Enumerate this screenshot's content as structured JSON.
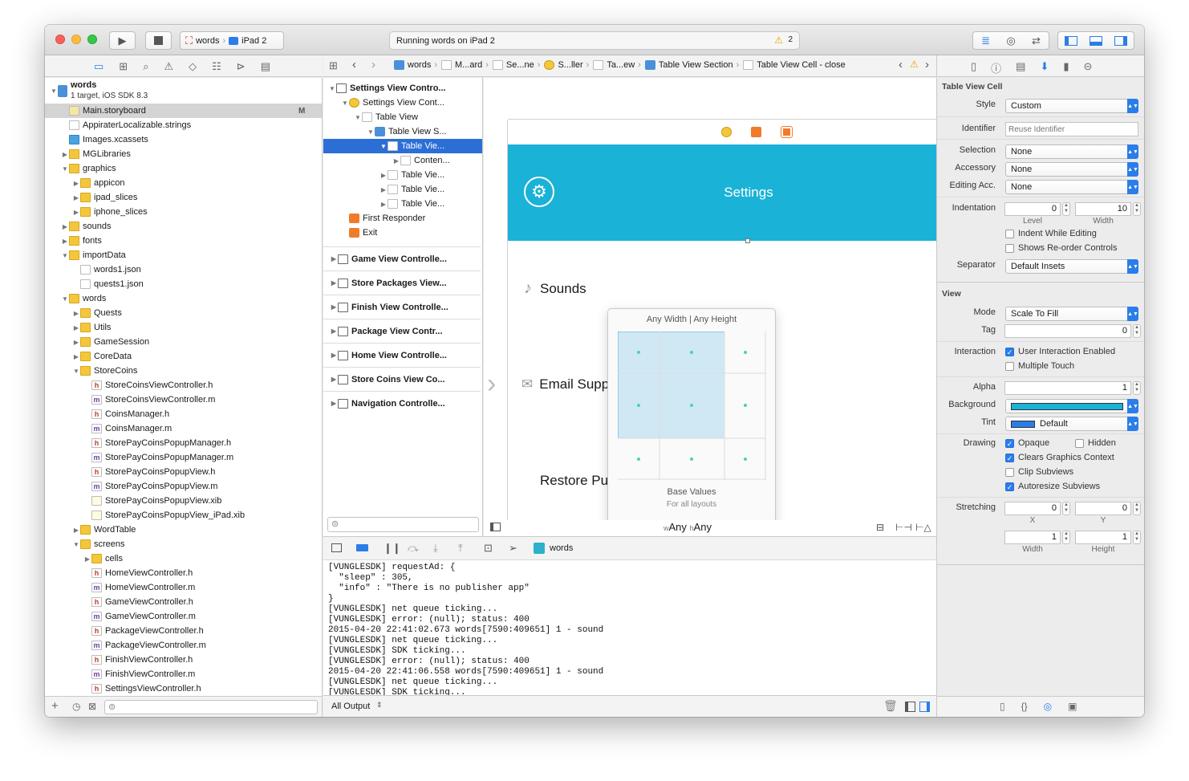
{
  "toolbar": {
    "scheme_target": "words",
    "scheme_device": "iPad 2",
    "activity_text": "Running words on iPad 2",
    "warning_count": "2"
  },
  "jumpbar": {
    "crumbs": [
      "words",
      "M...ard",
      "Se...ne",
      "S...ller",
      "Ta...ew",
      "Table View Section",
      "Table View Cell - close"
    ]
  },
  "navigator": {
    "project_name": "words",
    "project_subtitle": "1 target, iOS SDK 8.3",
    "badge_m": "M",
    "items": [
      {
        "label": "Main.storyboard",
        "indent": 1,
        "icon": "storyboard",
        "selected": true
      },
      {
        "label": "AppiraterLocalizable.strings",
        "indent": 1,
        "icon": "file"
      },
      {
        "label": "Images.xcassets",
        "indent": 1,
        "icon": "assets"
      },
      {
        "label": "MGLibraries",
        "indent": 1,
        "icon": "folder",
        "tri": "▶"
      },
      {
        "label": "graphics",
        "indent": 1,
        "icon": "folder",
        "tri": "▼"
      },
      {
        "label": "appicon",
        "indent": 2,
        "icon": "folder",
        "tri": "▶"
      },
      {
        "label": "ipad_slices",
        "indent": 2,
        "icon": "folder",
        "tri": "▶"
      },
      {
        "label": "iphone_slices",
        "indent": 2,
        "icon": "folder",
        "tri": "▶"
      },
      {
        "label": "sounds",
        "indent": 1,
        "icon": "folder",
        "tri": "▶"
      },
      {
        "label": "fonts",
        "indent": 1,
        "icon": "folder",
        "tri": "▶"
      },
      {
        "label": "importData",
        "indent": 1,
        "icon": "folder",
        "tri": "▼"
      },
      {
        "label": "words1.json",
        "indent": 2,
        "icon": "file"
      },
      {
        "label": "quests1.json",
        "indent": 2,
        "icon": "file"
      },
      {
        "label": "words",
        "indent": 1,
        "icon": "folder",
        "tri": "▼"
      },
      {
        "label": "Quests",
        "indent": 2,
        "icon": "folder",
        "tri": "▶"
      },
      {
        "label": "Utils",
        "indent": 2,
        "icon": "folder",
        "tri": "▶"
      },
      {
        "label": "GameSession",
        "indent": 2,
        "icon": "folder",
        "tri": "▶"
      },
      {
        "label": "CoreData",
        "indent": 2,
        "icon": "folder",
        "tri": "▶"
      },
      {
        "label": "StoreCoins",
        "indent": 2,
        "icon": "folder",
        "tri": "▼"
      },
      {
        "label": "StoreCoinsViewController.h",
        "indent": 3,
        "icon": "h"
      },
      {
        "label": "StoreCoinsViewController.m",
        "indent": 3,
        "icon": "m"
      },
      {
        "label": "CoinsManager.h",
        "indent": 3,
        "icon": "h"
      },
      {
        "label": "CoinsManager.m",
        "indent": 3,
        "icon": "m"
      },
      {
        "label": "StorePayCoinsPopupManager.h",
        "indent": 3,
        "icon": "h"
      },
      {
        "label": "StorePayCoinsPopupManager.m",
        "indent": 3,
        "icon": "m"
      },
      {
        "label": "StorePayCoinsPopupView.h",
        "indent": 3,
        "icon": "h"
      },
      {
        "label": "StorePayCoinsPopupView.m",
        "indent": 3,
        "icon": "m"
      },
      {
        "label": "StorePayCoinsPopupView.xib",
        "indent": 3,
        "icon": "xib"
      },
      {
        "label": "StorePayCoinsPopupView_iPad.xib",
        "indent": 3,
        "icon": "xib"
      },
      {
        "label": "WordTable",
        "indent": 2,
        "icon": "folder",
        "tri": "▶"
      },
      {
        "label": "screens",
        "indent": 2,
        "icon": "folder",
        "tri": "▼"
      },
      {
        "label": "cells",
        "indent": 3,
        "icon": "folder",
        "tri": "▶"
      },
      {
        "label": "HomeViewController.h",
        "indent": 3,
        "icon": "h"
      },
      {
        "label": "HomeViewController.m",
        "indent": 3,
        "icon": "m"
      },
      {
        "label": "GameViewController.h",
        "indent": 3,
        "icon": "h"
      },
      {
        "label": "GameViewController.m",
        "indent": 3,
        "icon": "m"
      },
      {
        "label": "PackageViewController.h",
        "indent": 3,
        "icon": "h"
      },
      {
        "label": "PackageViewController.m",
        "indent": 3,
        "icon": "m"
      },
      {
        "label": "FinishViewController.h",
        "indent": 3,
        "icon": "h"
      },
      {
        "label": "FinishViewController.m",
        "indent": 3,
        "icon": "m"
      },
      {
        "label": "SettingsViewController.h",
        "indent": 3,
        "icon": "h"
      }
    ]
  },
  "outline": {
    "tree": [
      {
        "label": "Settings View Contro...",
        "indent": 0,
        "tri": "▼",
        "icon": "vc",
        "bold": true
      },
      {
        "label": "Settings View Cont...",
        "indent": 1,
        "tri": "▼",
        "icon": "yel"
      },
      {
        "label": "Table View",
        "indent": 2,
        "tri": "▼",
        "icon": "gen"
      },
      {
        "label": "Table View S...",
        "indent": 3,
        "tri": "▼",
        "icon": "blue"
      },
      {
        "label": "Table Vie...",
        "indent": 4,
        "tri": "▼",
        "icon": "gen",
        "selected": true
      },
      {
        "label": "Conten...",
        "indent": 5,
        "tri": "▶",
        "icon": "gen"
      },
      {
        "label": "Table Vie...",
        "indent": 4,
        "tri": "▶",
        "icon": "gen"
      },
      {
        "label": "Table Vie...",
        "indent": 4,
        "tri": "▶",
        "icon": "gen"
      },
      {
        "label": "Table Vie...",
        "indent": 4,
        "tri": "▶",
        "icon": "gen"
      },
      {
        "label": "First Responder",
        "indent": 1,
        "tri": "",
        "icon": "orange"
      },
      {
        "label": "Exit",
        "indent": 1,
        "tri": "",
        "icon": "orange"
      }
    ],
    "scenes": [
      "Game View Controlle...",
      "Store Packages View...",
      "Finish View Controlle...",
      "Package View Contr...",
      "Home View Controlle...",
      "Store Coins View Co...",
      "Navigation Controlle..."
    ]
  },
  "canvas": {
    "header_title": "Settings",
    "rows": [
      "Sounds",
      "Email Supp",
      "Restore Pu"
    ],
    "header_color": "#1ab2d6",
    "size_class_w": "Any",
    "size_class_h": "Any",
    "size_w_prefix": "w",
    "size_h_prefix": "h"
  },
  "sizeclass_popover": {
    "title": "Any Width | Any Height",
    "footer_title": "Base Values",
    "footer_sub": "For all layouts"
  },
  "debug": {
    "target": "words",
    "output_filter": "All Output",
    "console_text": "[VUNGLESDK] requestAd: {\n  \"sleep\" : 305,\n  \"info\" : \"There is no publisher app\"\n}\n[VUNGLESDK] net queue ticking...\n[VUNGLESDK] error: (null); status: 400\n2015-04-20 22:41:02.673 words[7590:409651] 1 - sound\n[VUNGLESDK] net queue ticking...\n[VUNGLESDK] SDK ticking...\n[VUNGLESDK] error: (null); status: 400\n2015-04-20 22:41:06.558 words[7590:409651] 1 - sound\n[VUNGLESDK] net queue ticking...\n[VUNGLESDK] SDK ticking..."
  },
  "inspector": {
    "section_cell": "Table View Cell",
    "style_label": "Style",
    "style_value": "Custom",
    "identifier_label": "Identifier",
    "identifier_placeholder": "Reuse Identifier",
    "selection_label": "Selection",
    "selection_value": "None",
    "accessory_label": "Accessory",
    "accessory_value": "None",
    "editing_acc_label": "Editing Acc.",
    "editing_acc_value": "None",
    "indentation_label": "Indentation",
    "indent_level": "0",
    "indent_width": "10",
    "level_label": "Level",
    "width_label": "Width",
    "indent_while_editing": "Indent While Editing",
    "shows_reorder": "Shows Re-order Controls",
    "separator_label": "Separator",
    "separator_value": "Default Insets",
    "section_view": "View",
    "mode_label": "Mode",
    "mode_value": "Scale To Fill",
    "tag_label": "Tag",
    "tag_value": "0",
    "interaction_label": "Interaction",
    "user_interaction": "User Interaction Enabled",
    "multiple_touch": "Multiple Touch",
    "alpha_label": "Alpha",
    "alpha_value": "1",
    "background_label": "Background",
    "background_color": "#1ab2d6",
    "tint_label": "Tint",
    "tint_value": "Default",
    "tint_color": "#2b7de9",
    "drawing_label": "Drawing",
    "opaque": "Opaque",
    "hidden": "Hidden",
    "clears_graphics": "Clears Graphics Context",
    "clip_subviews": "Clip Subviews",
    "autoresize": "Autoresize Subviews",
    "stretching_label": "Stretching",
    "stretch_x": "0",
    "stretch_y": "0",
    "stretch_w": "1",
    "stretch_h": "1",
    "x_label": "X",
    "y_label": "Y",
    "w_label": "Width",
    "h_label": "Height"
  }
}
